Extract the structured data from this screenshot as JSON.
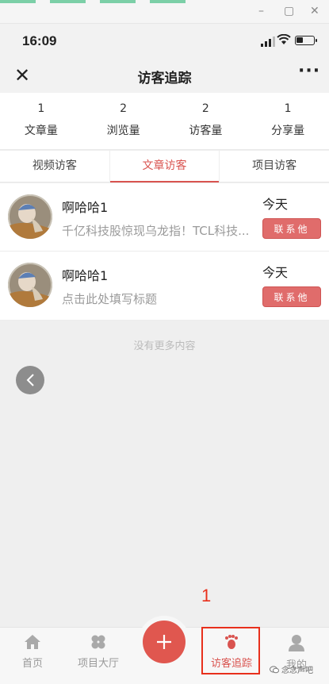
{
  "status": {
    "time": "16:09"
  },
  "navbar": {
    "title": "访客追踪",
    "close_icon": "close-icon",
    "more_icon": "more-icon"
  },
  "stats": [
    {
      "value": "1",
      "label": "文章量"
    },
    {
      "value": "2",
      "label": "浏览量"
    },
    {
      "value": "2",
      "label": "访客量"
    },
    {
      "value": "1",
      "label": "分享量"
    }
  ],
  "tabs": [
    {
      "label": "视频访客",
      "active": false
    },
    {
      "label": "文章访客",
      "active": true
    },
    {
      "label": "项目访客",
      "active": false
    }
  ],
  "visitors": [
    {
      "name": "啊哈哈1",
      "content": "千亿科技股惊现乌龙指！TCL科技...",
      "date": "今天",
      "button": "联系他"
    },
    {
      "name": "啊哈哈1",
      "content": "点击此处填写标题",
      "date": "今天",
      "button": "联系他"
    }
  ],
  "no_more": "没有更多内容",
  "annotation": "1",
  "tabbar": {
    "home": "首页",
    "project_hall": "项目大厅",
    "visitor_track": "访客追踪",
    "mine": "我的"
  },
  "watermark": "念念声吧",
  "colors": {
    "accent": "#d9534f",
    "button": "#e06c6b",
    "fab": "#e0574f",
    "annotation": "#e8301c"
  }
}
